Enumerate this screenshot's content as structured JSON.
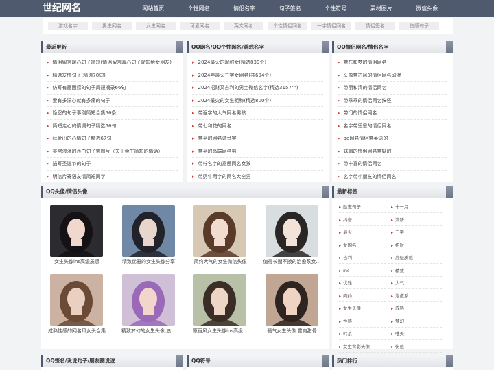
{
  "site": {
    "logo": "世纪网名"
  },
  "nav": [
    "网站首页",
    "个性网名",
    "情侣名字",
    "句子签名",
    "个性符号",
    "素材图片",
    "微信头像"
  ],
  "subnav": [
    "游戏名字",
    "男生网名",
    "女生网名",
    "可爱网名",
    "英文网名",
    "个性情侣网名",
    "一字情侣网名",
    "情侣签名",
    "伤感句子"
  ],
  "latest": {
    "title": "最近更新",
    "items": [
      "情侣留言暖心句子简短(情侣留言暖心句子简短给女朋友)",
      "精选友情句子(精选70句)",
      "仿写有画面感的句子简短摘录66句",
      "爱有多深心就有多痛的句子",
      "隐忍的句子事例简短合集56条",
      "简短走心的情调句子精选56句",
      "拜爱山的心情句子精选67句",
      "非常浪漫的表白句子带图片（关于余生简短的情话）",
      "描写圣诞节的句子",
      "明信片寄语友情简短同学"
    ]
  },
  "qqnames": {
    "title": "QQ网名/QQ个性网名/游戏名字",
    "items": [
      "2024最火的昵称女(精选839个)",
      "2024年最火三字女网名(共694个)",
      "2024招财又吉利的男士微信名字(精选3157个)",
      "2024最火的女生昵称(精选800个)",
      "带强字的大气网名男孩",
      "带七和花的网名",
      "带平的网名谐音字",
      "带平的高端网名男",
      "带柠名字的意思网名女孩",
      "带奶牛两字的网名大全男"
    ]
  },
  "couple": {
    "title": "QQ情侣网名/情侣名字",
    "items": [
      "带东和梦的情侣网名",
      "头像带古风的情侣网名动漫",
      "带丽和清的情侣网名",
      "带乖乖的情侣网名搞怪",
      "带门的情侣网名",
      "名字带思思的情侣网名",
      "qq网名情侣带英语的",
      "妹媚的情侣网名带妖的",
      "带十喜的情侣网名",
      "名字带小朋友的情侣网名"
    ]
  },
  "avatars": {
    "title": "QQ头像/情侣头像",
    "items": [
      {
        "caption": "女生头像ins高级质感",
        "bg": "#2c2c30",
        "skin": "#f0d8cc",
        "hair": "#141214"
      },
      {
        "caption": "精致优雅的女生头像分享",
        "bg": "#6f88a6",
        "skin": "#e8d6cc",
        "hair": "#22232a"
      },
      {
        "caption": "简约大气的女生微信头像",
        "bg": "#d7c8b4",
        "skin": "#f2dccf",
        "hair": "#5a3a28"
      },
      {
        "caption": "值得长期不换的治愈系女…",
        "bg": "#d8dde0",
        "skin": "#f3e2d8",
        "hair": "#2a2626"
      },
      {
        "caption": "成熟性感的网名风女头合集",
        "bg": "#cbb2a2",
        "skin": "#ead0c0",
        "hair": "#6b4a36"
      },
      {
        "caption": "精致梦幻的女生头像,浪…",
        "bg": "#cfc0d8",
        "skin": "#f2d6cc",
        "hair": "#9a6ab8"
      },
      {
        "caption": "原宿风女生头像ins高级…",
        "bg": "#b9c0a8",
        "skin": "#eed6c6",
        "hair": "#3a2e26"
      },
      {
        "caption": "骚气女生头像 露肩甜骨",
        "bg": "#c2a694",
        "skin": "#efd4c4",
        "hair": "#2e2420"
      }
    ]
  },
  "tags": {
    "title": "最新标签",
    "items": [
      "励志句子",
      "十一月",
      "抖音",
      "清新",
      "最火",
      "三字",
      "女网名",
      "招财",
      "吉利",
      "高级质感",
      "ins",
      "精致",
      "优雅",
      "大气",
      "简约",
      "治愈系",
      "女生头像",
      "成熟",
      "性感",
      "梦幻",
      "韩系",
      "唯美",
      "女生背影头像",
      "伤感"
    ]
  },
  "bottom": {
    "sign": "QQ签名/说说句子/朋友圈说说",
    "symbols": "QQ符号",
    "hot": "热门排行"
  },
  "colors": {
    "nav_bg": "#4f5a6e",
    "accent": "#c8372d"
  }
}
